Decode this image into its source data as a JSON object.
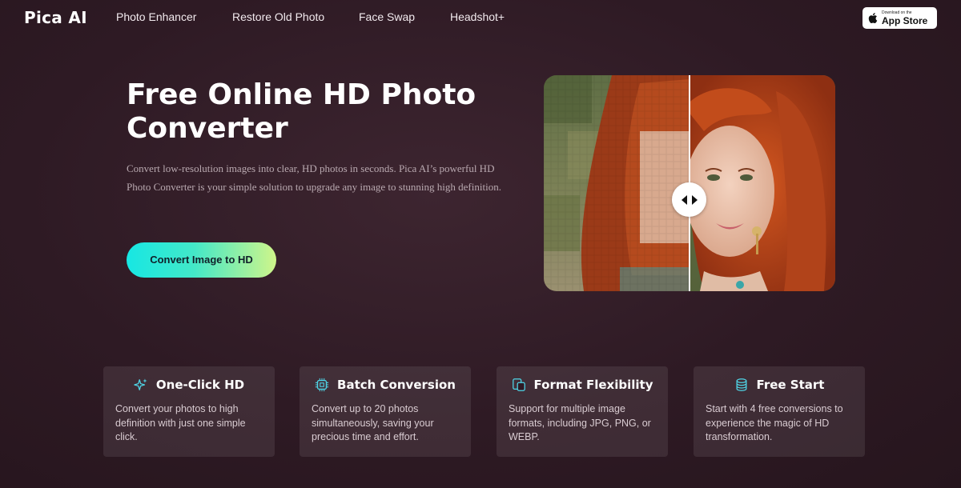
{
  "header": {
    "logo": "Pica AI",
    "nav": [
      "Photo Enhancer",
      "Restore Old Photo",
      "Face Swap",
      "Headshot+"
    ],
    "app_store": {
      "small_label": "Download on the",
      "label": "App Store",
      "icon": "apple-icon"
    }
  },
  "hero": {
    "title": "Free Online HD Photo Converter",
    "description": "Convert low-resolution images into clear, HD photos in seconds. Pica AI’s powerful HD Photo Converter is your simple solution to upgrade any image to stunning high definition.",
    "cta_label": "Convert Image to HD",
    "compare_handle_icon": "compare-arrows-icon"
  },
  "features": [
    {
      "icon": "sparkle-icon",
      "title": "One-Click HD",
      "text": "Convert your photos to high definition with just one simple click."
    },
    {
      "icon": "chip-icon",
      "title": "Batch Conversion",
      "text": "Convert up to 20 photos simultaneously, saving your precious time and effort."
    },
    {
      "icon": "format-icon",
      "title": "Format Flexibility",
      "text": "Support for multiple image formats, including JPG, PNG, or WEBP."
    },
    {
      "icon": "database-icon",
      "title": "Free Start",
      "text": "Start with 4 free conversions to experience the magic of HD transformation."
    }
  ],
  "colors": {
    "background": "#2e1a24",
    "cta_gradient_start": "#17e7e3",
    "cta_gradient_end": "#cff58a",
    "feature_icon": "#4fd6e8"
  }
}
